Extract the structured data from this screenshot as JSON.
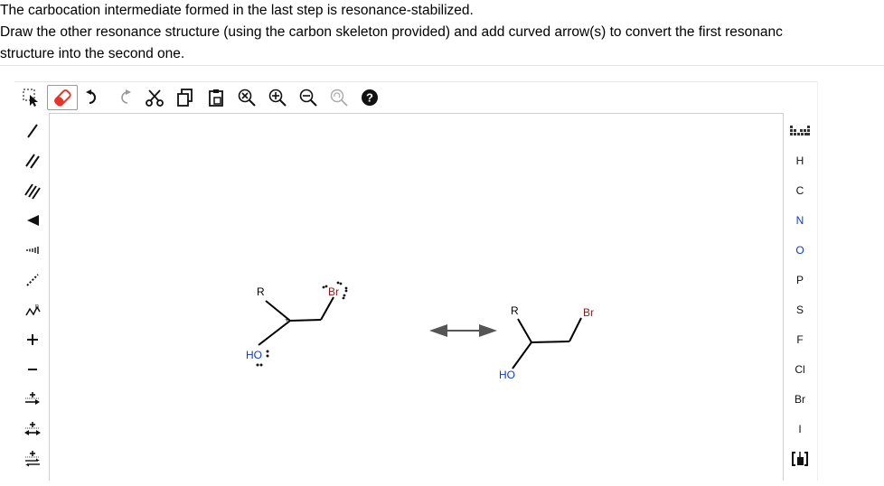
{
  "question": {
    "line1": "The carbocation intermediate formed in the last step is resonance-stabilized.",
    "line2": "Draw the other resonance structure (using the carbon skeleton provided) and add curved arrow(s) to convert the first resonanc",
    "line3": "structure into the second one."
  },
  "toolbar": {
    "tools": [
      "select-lasso-icon",
      "eraser-icon",
      "undo-icon",
      "redo-icon",
      "cut-icon",
      "copy-icon",
      "paste-icon",
      "zoom-reset-icon",
      "zoom-in-icon",
      "zoom-out-icon",
      "clean-icon",
      "help-icon"
    ],
    "help_label": "?"
  },
  "left_tools": [
    "single-bond-icon",
    "double-bond-icon",
    "triple-bond-icon",
    "wedge-bond-icon",
    "hash-bond-icon",
    "dotted-bond-icon",
    "chain-icon",
    "positive-charge-icon",
    "negative-charge-icon",
    "single-arrow-icon",
    "double-arrow-icon",
    "equilibrium-arrow-icon"
  ],
  "left_labels": {
    "plus": "+",
    "minus": "−"
  },
  "right_tools": {
    "periodic_table_icon": "periodic-table-icon",
    "elements": [
      "H",
      "C",
      "N",
      "O",
      "P",
      "S",
      "F",
      "Cl",
      "Br",
      "I"
    ],
    "bracket_icon": "bracket-icon"
  },
  "molecule1": {
    "r_label": "R",
    "oh_label": "HO",
    "br_label": "Br",
    "charge": "+"
  },
  "molecule2": {
    "r_label": "R",
    "oh_label": "HO",
    "br_label": "Br"
  },
  "colors": {
    "oxygen": "#0a3bd6",
    "bromine": "#8b1a1a",
    "eraser": "#e8332a",
    "bond": "#000000"
  }
}
